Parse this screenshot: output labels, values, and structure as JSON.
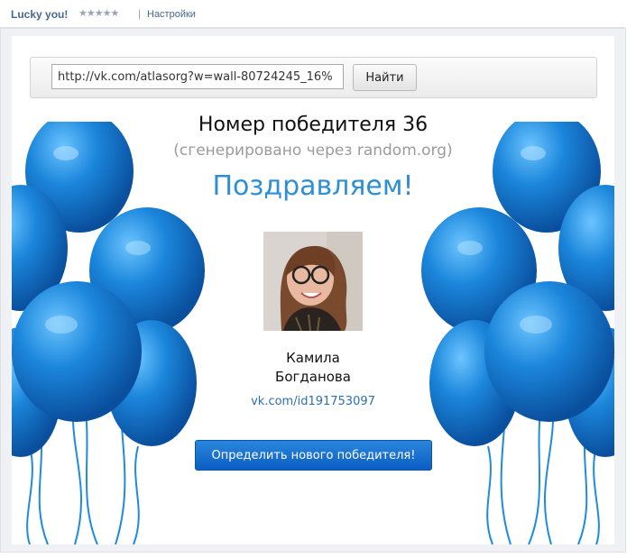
{
  "header": {
    "app_title": "Lucky you!",
    "rating_stars": "★★★★★",
    "separator": "|",
    "settings_label": "Настройки"
  },
  "search": {
    "value": "http://vk.com/atlasorg?w=wall-80724245_16%",
    "button_label": "Найти"
  },
  "result": {
    "winner_number_text": "Номер победителя 36",
    "generated_note": "(сгенерировано через random.org)",
    "congrats": "Поздравляем!",
    "winner_first_name": "Камила",
    "winner_last_name": "Богданова",
    "winner_link": "vk.com/id191753097",
    "new_winner_button": "Определить нового победителя!"
  },
  "colors": {
    "accent": "#2e8fd4",
    "link": "#2b6fb5",
    "button": "#0b5ec2",
    "balloon": "#1b7fd2"
  },
  "icons": {
    "rating": "star-icon",
    "decoration": "balloon-icon"
  }
}
